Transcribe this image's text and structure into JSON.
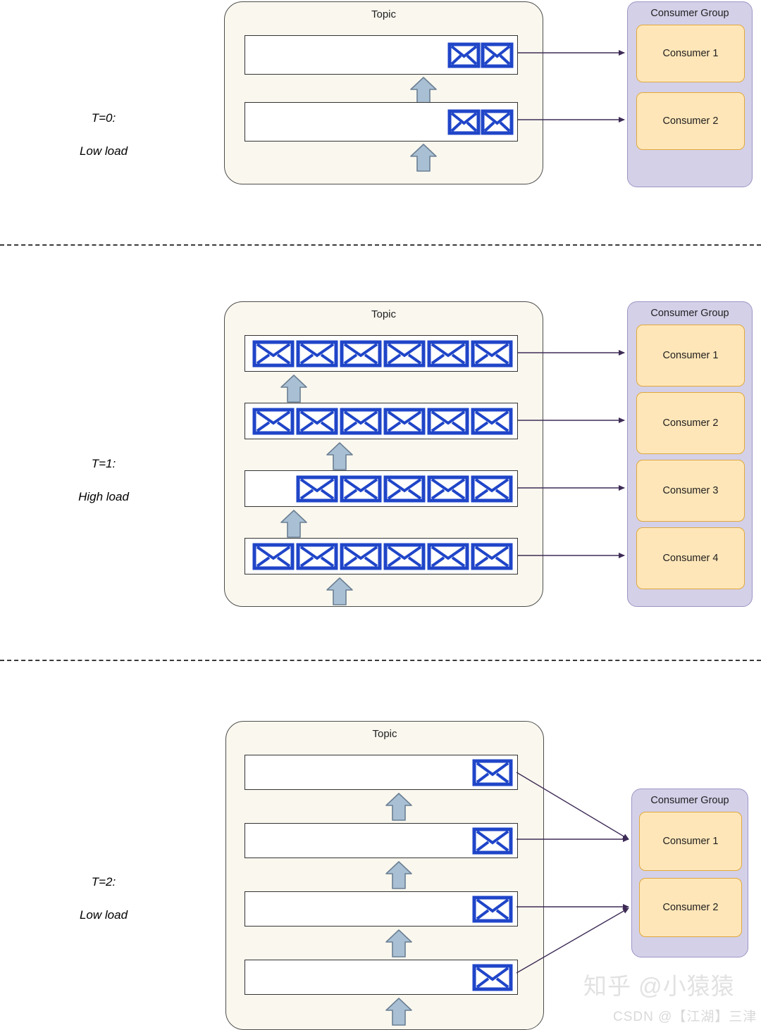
{
  "diagram": {
    "title": "Kafka topic partitions consumed by a consumer group over time",
    "colors": {
      "topic_fill": "#faf7ee",
      "topic_stroke": "#4d4d4d",
      "partition_fill": "#ffffff",
      "partition_stroke": "#333333",
      "envelope": "#1f45c8",
      "producer_arrow_fill": "#a9c0d4",
      "producer_arrow_stroke": "#6b7f93",
      "consumer_group_fill": "#d4d0e8",
      "consumer_group_stroke": "#9e95c4",
      "consumer_fill": "#ffe6b8",
      "consumer_stroke": "#e0a93c",
      "link_arrow": "#3d2b56",
      "separator": "#3a3a3a"
    },
    "labels": {
      "topic": "Topic",
      "consumer_group": "Consumer Group"
    },
    "sections": [
      {
        "id": "t0",
        "time_label_line1": "T=0:",
        "time_label_line2": "Low load",
        "topic_title": "Topic",
        "consumer_group_title": "Consumer Group",
        "partitions": [
          {
            "message_count": 2,
            "align": "right",
            "consumer_index": 0
          },
          {
            "message_count": 2,
            "align": "right",
            "consumer_index": 1
          }
        ],
        "consumers": [
          {
            "label": "Consumer 1"
          },
          {
            "label": "Consumer 2"
          }
        ]
      },
      {
        "id": "t1",
        "time_label_line1": "T=1:",
        "time_label_line2": "High load",
        "topic_title": "Topic",
        "consumer_group_title": "Consumer Group",
        "partitions": [
          {
            "message_count": 6,
            "align": "full",
            "consumer_index": 0
          },
          {
            "message_count": 6,
            "align": "full",
            "consumer_index": 1
          },
          {
            "message_count": 5,
            "align": "right",
            "consumer_index": 2
          },
          {
            "message_count": 6,
            "align": "full",
            "consumer_index": 3
          }
        ],
        "consumers": [
          {
            "label": "Consumer 1"
          },
          {
            "label": "Consumer 2"
          },
          {
            "label": "Consumer 3"
          },
          {
            "label": "Consumer 4"
          }
        ]
      },
      {
        "id": "t2",
        "time_label_line1": "T=2:",
        "time_label_line2": "Low load",
        "topic_title": "Topic",
        "consumer_group_title": "Consumer Group",
        "partitions": [
          {
            "message_count": 1,
            "align": "right",
            "consumer_index": 0
          },
          {
            "message_count": 1,
            "align": "right",
            "consumer_index": 0
          },
          {
            "message_count": 1,
            "align": "right",
            "consumer_index": 1
          },
          {
            "message_count": 1,
            "align": "right",
            "consumer_index": 1
          }
        ],
        "consumers": [
          {
            "label": "Consumer 1"
          },
          {
            "label": "Consumer 2"
          }
        ]
      }
    ],
    "watermarks": {
      "zhihu": "知乎 @小猿猿",
      "csdn": "CSDN @【江湖】三津"
    }
  }
}
